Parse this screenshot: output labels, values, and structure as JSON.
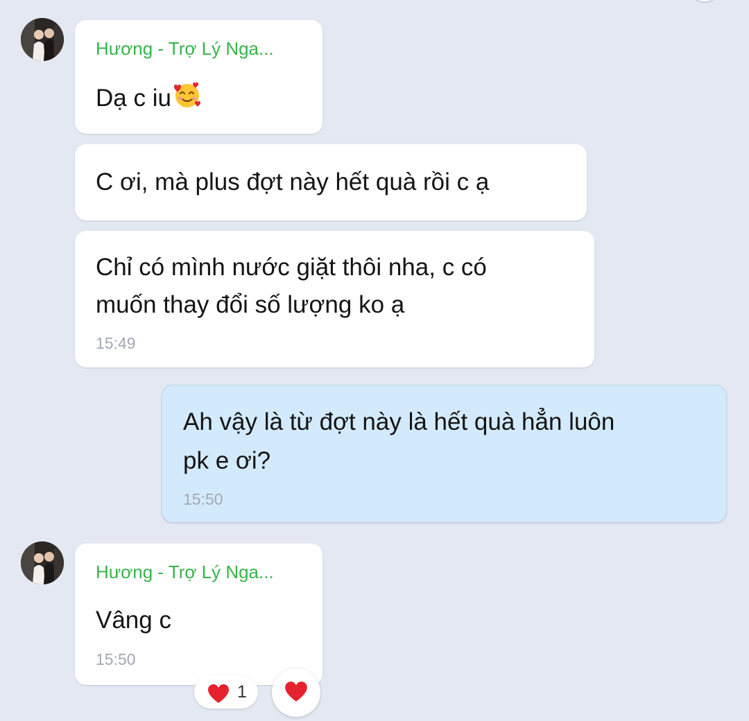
{
  "chat": {
    "messages": [
      {
        "sender": "Hương - Trợ Lý Nga...",
        "text": "Dạ c iu",
        "emoji": "smiling-face-with-hearts"
      },
      {
        "text": "C ơi, mà plus đợt này hết quà rồi c ạ"
      },
      {
        "lines": [
          "Chỉ có mình nước giặt thôi nha, c có",
          "muốn thay đổi số lượng ko ạ"
        ],
        "time": "15:49"
      },
      {
        "mine": true,
        "lines": [
          "Ah vậy là từ đợt này là hết quà hẳn luôn",
          "pk e ơi?"
        ],
        "time": "15:50"
      },
      {
        "sender": "Hương - Trợ Lý Nga...",
        "text": "Vâng c",
        "time": "15:50",
        "reaction": {
          "icon": "heart",
          "count": "1"
        }
      }
    ]
  },
  "colors": {
    "background": "#e4e8f2",
    "incoming_bubble": "#ffffff",
    "outgoing_bubble": "#d3eafc",
    "sender_name": "#35b44a",
    "timestamp": "#a3a8b0",
    "heart": "#e5232f"
  }
}
